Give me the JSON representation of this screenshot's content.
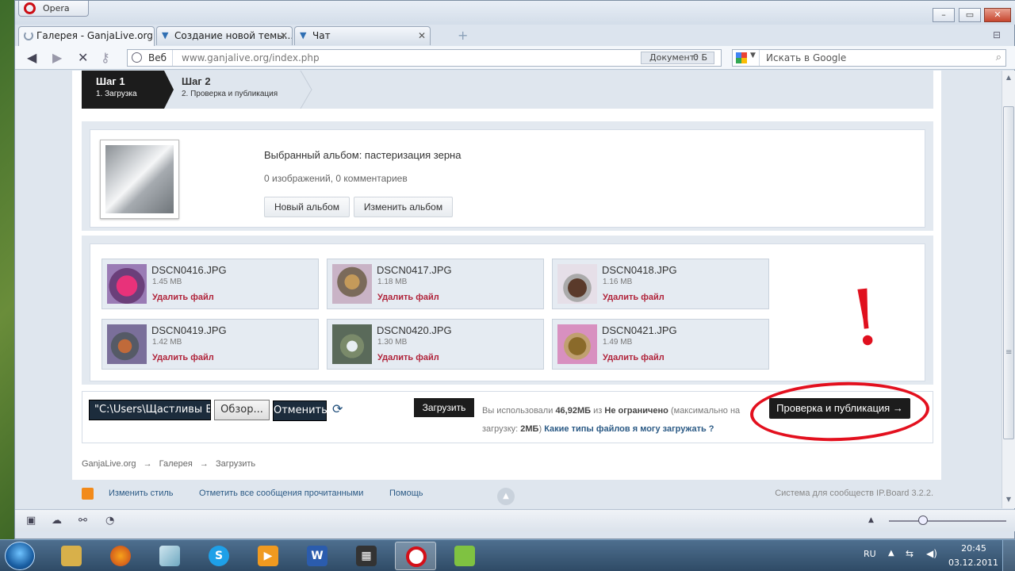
{
  "browser": {
    "menu_label": "Opera",
    "tabs": [
      {
        "title": "Галерея - GanjaLive.org"
      },
      {
        "title": "Создание новой темы..."
      },
      {
        "title": "Чат"
      }
    ],
    "address_web_label": "Веб",
    "url": "www.ganjalive.org/index.php",
    "doc_label": "Документ:",
    "doc_value": "0 Б",
    "search_placeholder": "Искать в Google"
  },
  "steps": [
    {
      "title": "Шаг 1",
      "subtitle": "1. Загрузка"
    },
    {
      "title": "Шаг 2",
      "subtitle": "2. Проверка и публикация"
    }
  ],
  "album": {
    "selected": "Выбранный альбом: пастеризация зерна",
    "stats": "0 изображений, 0 комментариев",
    "new_album_label": "Новый альбом",
    "edit_album_label": "Изменить альбом"
  },
  "files": [
    {
      "name": "DSCN0416.JPG",
      "size": "1.45 MB",
      "delete": "Удалить файл"
    },
    {
      "name": "DSCN0417.JPG",
      "size": "1.18 MB",
      "delete": "Удалить файл"
    },
    {
      "name": "DSCN0418.JPG",
      "size": "1.16 MB",
      "delete": "Удалить файл"
    },
    {
      "name": "DSCN0419.JPG",
      "size": "1.42 MB",
      "delete": "Удалить файл"
    },
    {
      "name": "DSCN0420.JPG",
      "size": "1.30 MB",
      "delete": "Удалить файл"
    },
    {
      "name": "DSCN0421.JPG",
      "size": "1.49 MB",
      "delete": "Удалить файл"
    }
  ],
  "annotation_mark": "!",
  "upload": {
    "file_path": "\"C:\\Users\\Щастливы Вместе",
    "browse_label": "Обзор...",
    "cancel_label": "Отменить",
    "upload_label": "Загрузить",
    "usage_prefix": "Вы использовали",
    "usage_used": "46,92МБ",
    "usage_of": "из",
    "usage_limit": "Не ограничено",
    "usage_max_prefix": "(максимально на загрузку:",
    "usage_max": "2МБ",
    "usage_max_suffix": ")",
    "file_types_link": "Какие типы файлов я могу загружать ?",
    "publish_label": "Проверка и публикация →"
  },
  "breadcrumb": [
    "GanjaLive.org",
    "→",
    "Галерея",
    "→",
    "Загрузить"
  ],
  "footer": {
    "change_style": "Изменить стиль",
    "mark_read": "Отметить все сообщения прочитанными",
    "help": "Помощь",
    "powered_by": "Система для сообществ IP.Board 3.2.2."
  },
  "taskbar": {
    "language": "RU",
    "time": "20:45",
    "date": "03.12.2011"
  },
  "colors": {
    "accent_dark": "#1c1c1c",
    "link": "#2b5a85",
    "delete": "#b0233a",
    "annotation_red": "#e3101e"
  }
}
